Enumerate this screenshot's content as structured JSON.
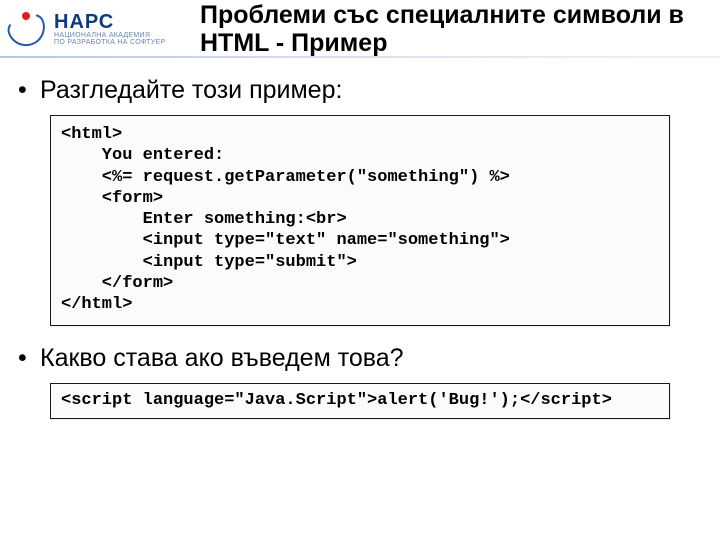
{
  "logo": {
    "name": "НАРС",
    "sub1": "НАЦИОНАЛНА АКАДЕМИЯ",
    "sub2": "ПО РАЗРАБОТКА НА СОФТУЕР"
  },
  "title": "Проблеми със специалните символи в HTML - Пример",
  "bullets": {
    "b1": "Разгледайте този пример:",
    "b2": "Какво става ако въведем това?"
  },
  "code1": "<html>\n    You entered:\n    <%= request.getParameter(\"something\") %>\n    <form>\n        Enter something:<br>\n        <input type=\"text\" name=\"something\">\n        <input type=\"submit\">\n    </form>\n</html>",
  "code2": "<script language=\"Java.Script\">alert('Bug!');</script>"
}
